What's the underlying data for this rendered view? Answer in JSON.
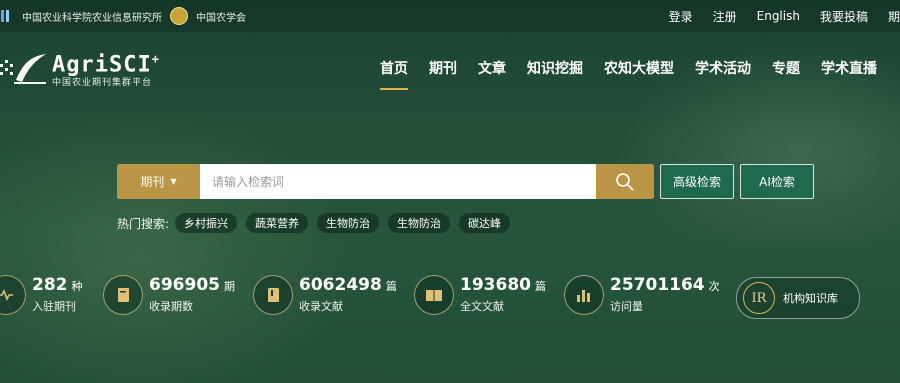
{
  "topbar": {
    "org1": "中国农业科学院农业信息研究所",
    "org2": "中国农学会",
    "links": [
      "登录",
      "注册",
      "English",
      "我要投稿",
      "期"
    ]
  },
  "logo": {
    "title": "AgriSCI",
    "plus": "+",
    "subtitle": "中国农业期刊集群平台"
  },
  "nav": [
    "首页",
    "期刊",
    "文章",
    "知识挖掘",
    "农知大模型",
    "学术活动",
    "专题",
    "学术直播"
  ],
  "search": {
    "category": "期刊",
    "placeholder": "请输入检索词",
    "advanced": "高级检索",
    "ai": "AI检索"
  },
  "hot": {
    "label": "热门搜索:",
    "tags": [
      "乡村振兴",
      "蔬菜营养",
      "生物防治",
      "生物防治",
      "碳达峰"
    ]
  },
  "stats": [
    {
      "num": "282",
      "unit": "种",
      "cap": "入驻期刊",
      "icon": "heart-line-icon"
    },
    {
      "num": "696905",
      "unit": "期",
      "cap": "收录期数",
      "icon": "journal-icon"
    },
    {
      "num": "6062498",
      "unit": "篇",
      "cap": "收录文献",
      "icon": "book-icon"
    },
    {
      "num": "193680",
      "unit": "篇",
      "cap": "全文文献",
      "icon": "open-book-icon"
    },
    {
      "num": "25701164",
      "unit": "次",
      "cap": "访问量",
      "icon": "bar-chart-icon"
    }
  ],
  "repo": {
    "badge": "IR",
    "label": "机构知识库"
  },
  "colors": {
    "gold": "#b99545",
    "green_button": "#1f6a4f"
  }
}
